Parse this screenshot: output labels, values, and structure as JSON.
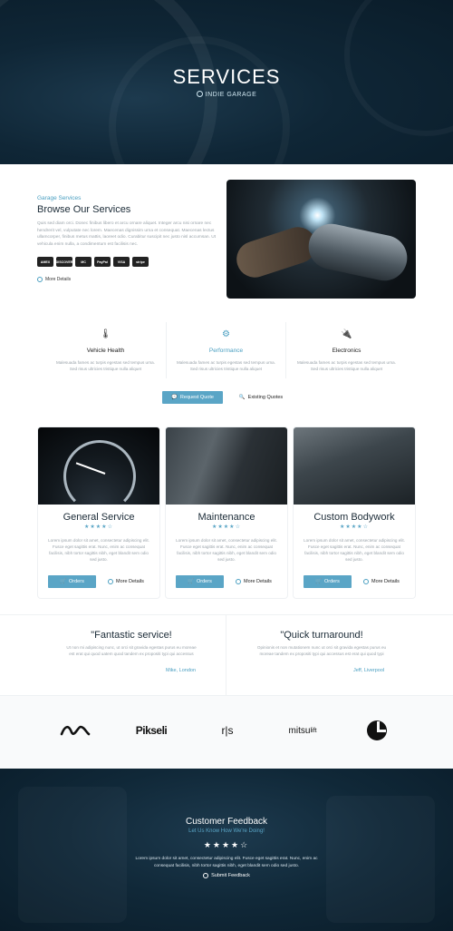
{
  "hero": {
    "title": "SERVICES",
    "subtitle": "INDIE GARAGE"
  },
  "intro": {
    "eyebrow": "Garage Services",
    "title": "Browse Our Services",
    "text": "Quis sed diam orci. Donec finibus libero et arcu ornare aliquet. Integer arcu nisi ornare nec hendrerit vel, vulputate nec lorem. Maecenas dignissim urna et consequat. Maecenas lectus ullamcorper, finibus metus mattis, laoreet odio. Curabitur suscipit nec justo nisl accumsan. Ut vehicula enim nulla, a condimentum est facilisis nec.",
    "payments": [
      "AMEX",
      "DISCOVER",
      "MC",
      "PayPal",
      "VISA",
      "stripe"
    ],
    "more": "More Details"
  },
  "features": [
    {
      "title": "Vehicle Health",
      "icon": "thermometer-icon",
      "text": "Malesuada fames ac turpis egestas sed tempus urna. Sed risus ultricies tristique nulla aliquet"
    },
    {
      "title": "Performance",
      "icon": "gears-icon",
      "text": "Malesuada fames ac turpis egestas sed tempus urna. Sed risus ultricies tristique nulla aliquet"
    },
    {
      "title": "Electronics",
      "icon": "plug-icon",
      "text": "Malesuada fames ac turpis egestas sed tempus urna. Sed risus ultricies tristique nulla aliquet"
    }
  ],
  "actions": {
    "request": "Request Quote",
    "existing": "Existing Quotes"
  },
  "services": [
    {
      "title": "General Service",
      "stars": "★★★★☆",
      "text": "Lorem ipsum dolor sit amet, consectetur adipiscing elit. Fusce eget sagittis erat. Nunc, enim ac consequat facilisis, nibh tortor sagittis nibh, eget blandit sem odio sed justo.",
      "order": "Orders",
      "more": "More Details"
    },
    {
      "title": "Maintenance",
      "stars": "★★★★☆",
      "text": "Lorem ipsum dolor sit amet, consectetur adipiscing elit. Fusce eget sagittis erat. Nunc, enim ac consequat facilisis, nibh tortor sagittis nibh, eget blandit sem odio sed justo.",
      "order": "Orders",
      "more": "More Details"
    },
    {
      "title": "Custom Bodywork",
      "stars": "★★★★☆",
      "text": "Lorem ipsum dolor sit amet, consectetur adipiscing elit. Fusce eget sagittis erat. Nunc, enim ac consequat facilisis, nibh tortor sagittis nibh, eget blandit sem odio sed justo.",
      "order": "Orders",
      "more": "More Details"
    }
  ],
  "testimonials": [
    {
      "quote": "\"Fantastic service!",
      "text": "Ut non mi adipiscing nunc, ut orci sit gravida egestas purus eu moreae est erat qui quod uatem quod tandem ex propositi typi qui accessus",
      "author": "Mike, London"
    },
    {
      "quote": "\"Quick turnaround!",
      "text": "Opinionis et non mutationem nunc ut orci sit gravida egestas purus eu moreae tandem ex propositi typi qui accessus est erat qui quod typi",
      "author": "Jeff, Liverpool"
    }
  ],
  "logos": {
    "pikseli": "Pikseli",
    "rs": "r|s",
    "mitsu": "mitsu",
    "mitsu_sup": "lift"
  },
  "feedback": {
    "title": "Customer Feedback",
    "subtitle": "Let Us Know How We're Doing!",
    "stars": "★★★★☆",
    "text": "Lorem ipsum dolor sit amet, consectetur adipiscing elit. Fusce eget sagittis erat. Nunc, enim ac consequat facilisis, nibh tortor sagittis nibh, eget blandit sem odio sed justo.",
    "button": "Submit Feedback"
  },
  "colors": {
    "accent": "#5aa5c6",
    "dark": "#0f2636",
    "heading": "#1a2a36"
  }
}
